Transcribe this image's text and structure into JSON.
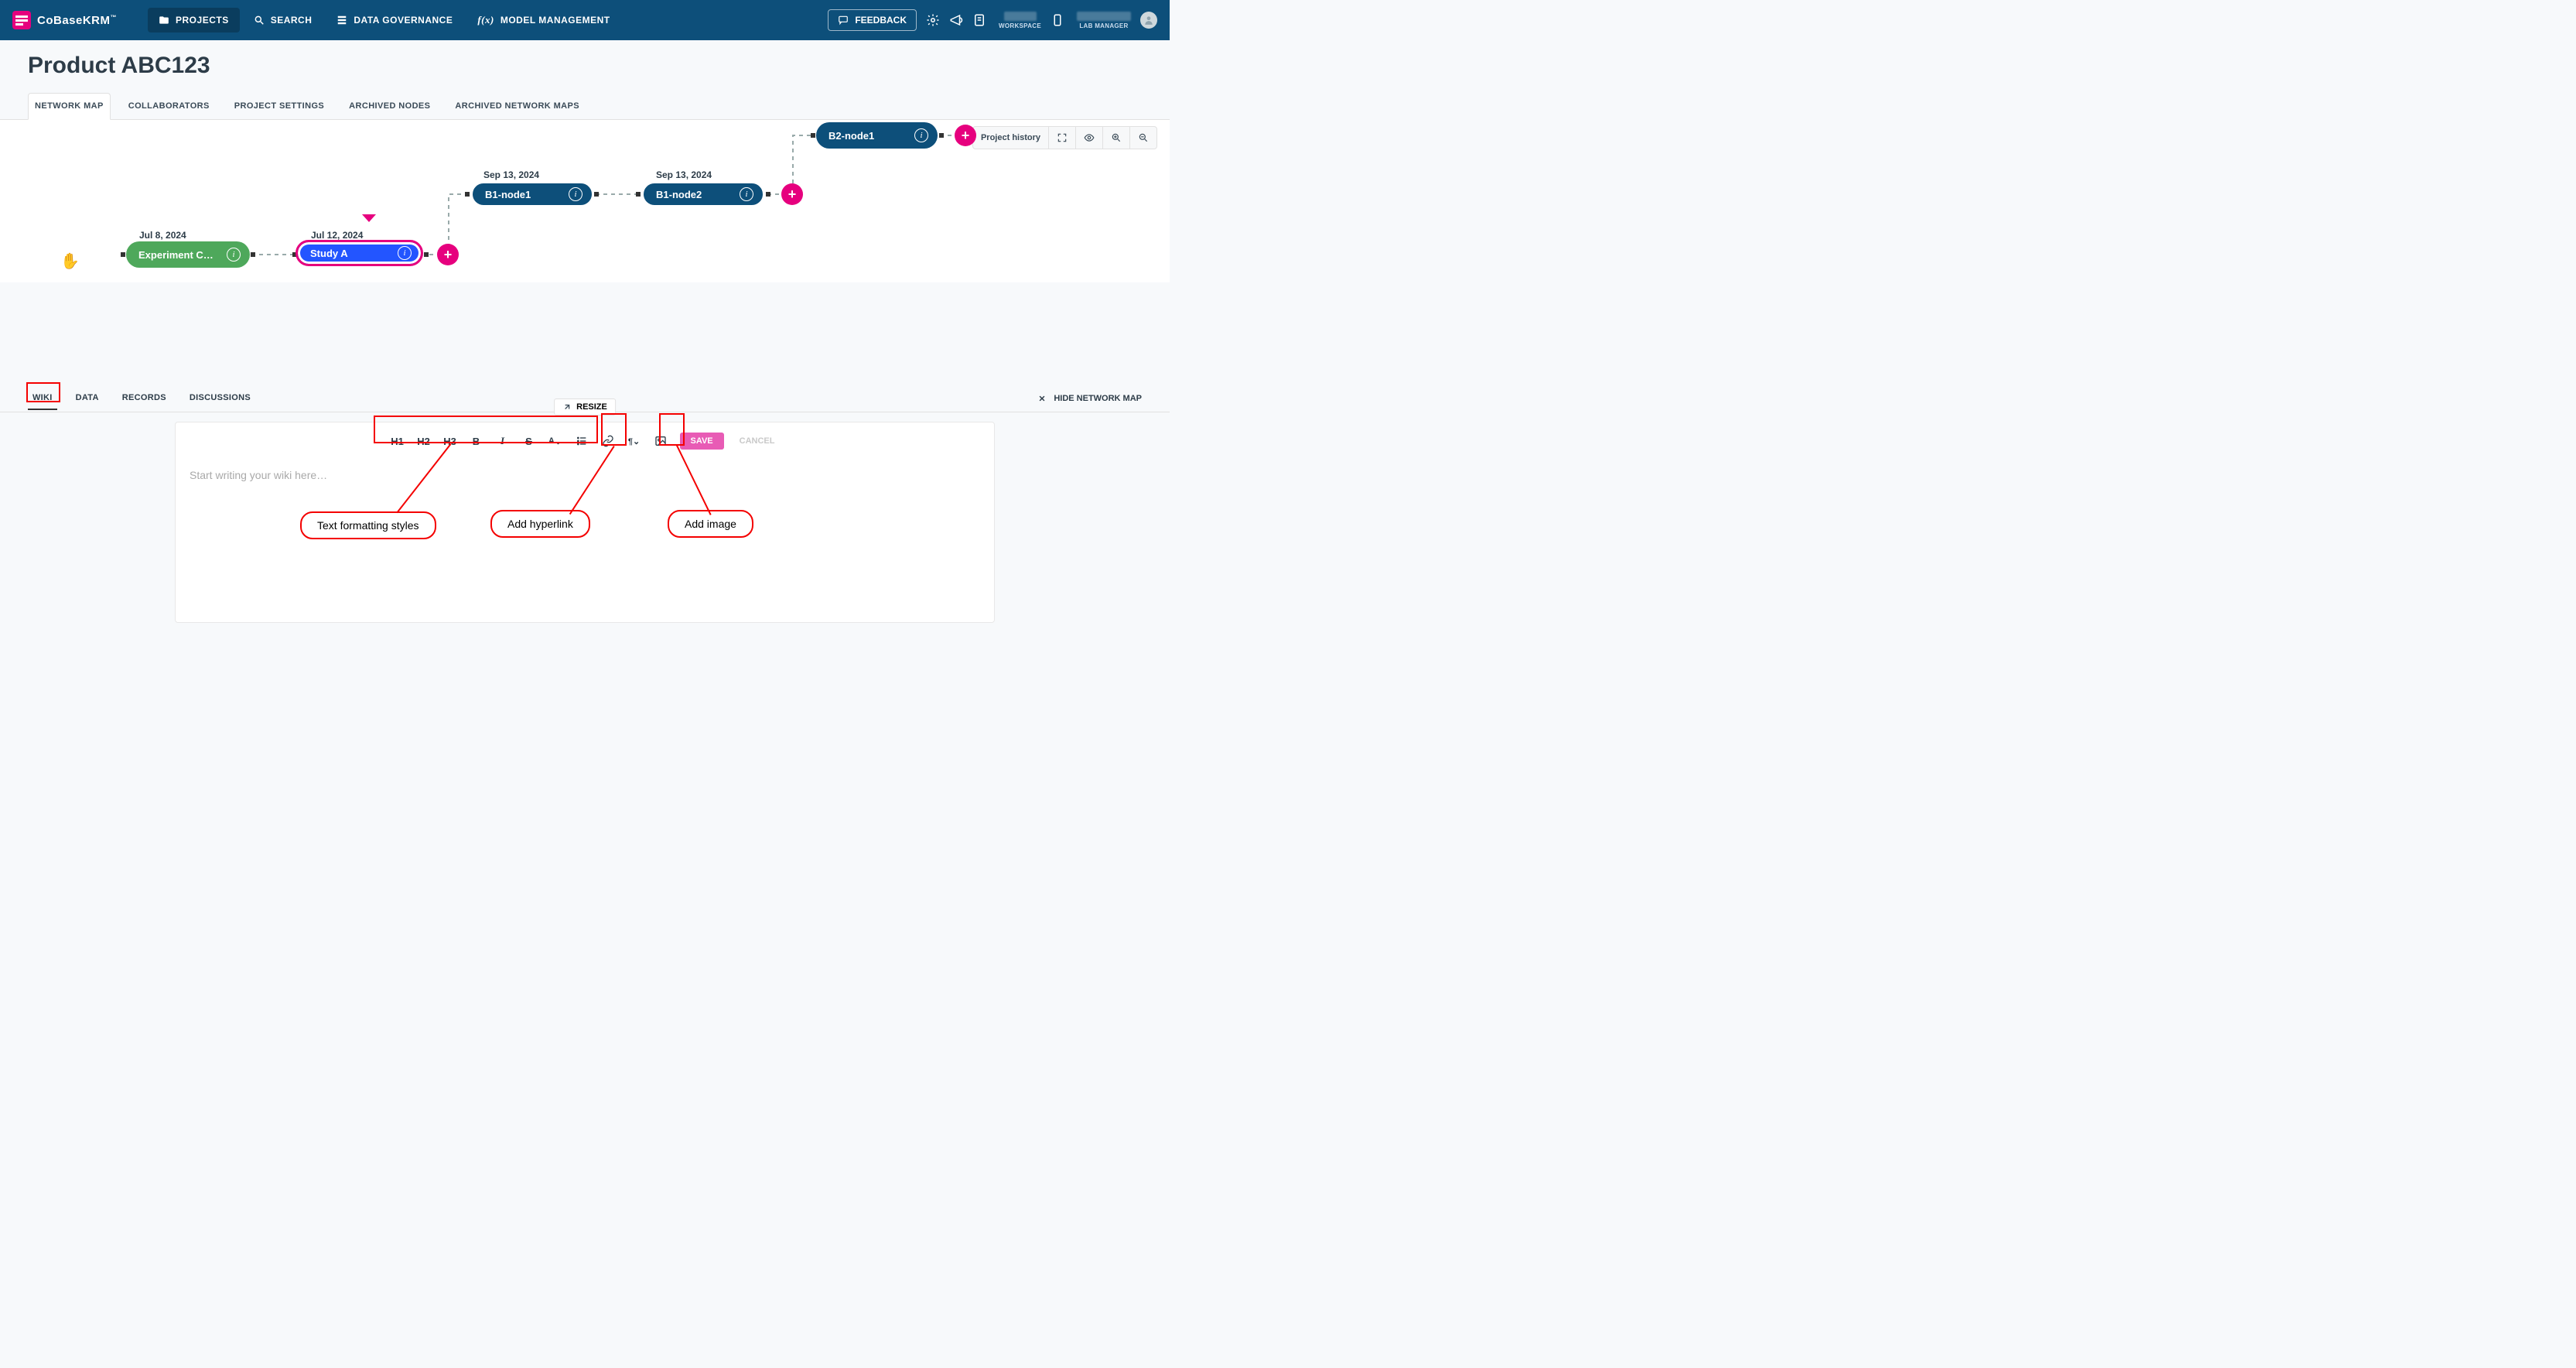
{
  "brand": "CoBaseKRM",
  "nav": {
    "projects": "PROJECTS",
    "search": "SEARCH",
    "governance": "DATA GOVERNANCE",
    "models": "MODEL MANAGEMENT"
  },
  "feedback": "FEEDBACK",
  "workspace_label": "WORKSPACE",
  "lab_label": "LAB MANAGER",
  "page_title": "Product ABC123",
  "tabs": {
    "network_map": "NETWORK MAP",
    "collaborators": "COLLABORATORS",
    "project_settings": "PROJECT SETTINGS",
    "archived_nodes": "ARCHIVED NODES",
    "archived_maps": "ARCHIVED NETWORK MAPS"
  },
  "map_toolbar": {
    "history": "Project history"
  },
  "nodes": {
    "exp": {
      "label": "Experiment C…",
      "date": "Jul 8, 2024"
    },
    "study": {
      "label": "Study A",
      "date": "Jul 12, 2024"
    },
    "b1n1": {
      "label": "B1-node1",
      "date": "Sep 13, 2024"
    },
    "b1n2": {
      "label": "B1-node2",
      "date": "Sep 13, 2024"
    },
    "b2n1": {
      "label": "B2-node1"
    }
  },
  "lower_tabs": {
    "wiki": "WIKI",
    "data": "DATA",
    "records": "RECORDS",
    "discussions": "DISCUSSIONS"
  },
  "resize": "RESIZE",
  "hide_map": "HIDE NETWORK MAP",
  "toolbar": {
    "h1": "H1",
    "h2": "H2",
    "h3": "H3",
    "b": "B",
    "i": "I",
    "a": "A",
    "save": "SAVE",
    "cancel": "CANCEL"
  },
  "wiki_placeholder": "Start writing your wiki here…",
  "callouts": {
    "format": "Text formatting styles",
    "link": "Add hyperlink",
    "image": "Add image"
  }
}
